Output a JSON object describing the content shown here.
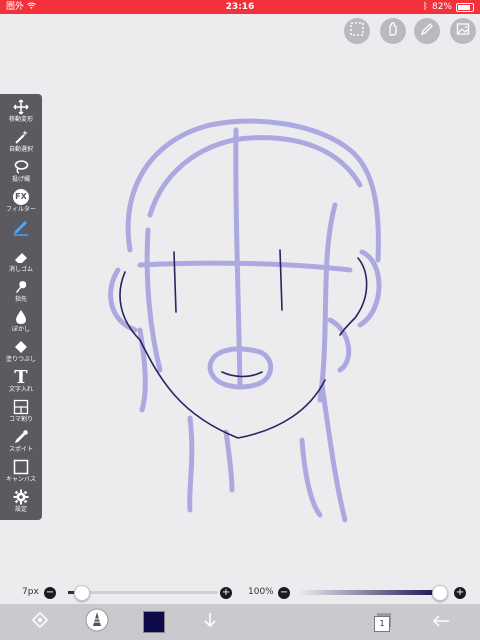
{
  "status": {
    "carrier": "圏外",
    "time": "23:16",
    "battery": "82%"
  },
  "top_buttons": [
    {
      "name": "selection-icon"
    },
    {
      "name": "hand-icon"
    },
    {
      "name": "pen-icon"
    },
    {
      "name": "layers-image-icon"
    }
  ],
  "tools": [
    {
      "label": "移動変形",
      "icon": "move-icon"
    },
    {
      "label": "自動選択",
      "icon": "magic-wand-icon"
    },
    {
      "label": "投げ縄",
      "icon": "lasso-icon"
    },
    {
      "label": "フィルター",
      "icon": "fx-icon",
      "glyph": "FX"
    },
    {
      "label": "",
      "icon": "pen-tool-icon",
      "active": true
    },
    {
      "label": "消しゴム",
      "icon": "eraser-icon"
    },
    {
      "label": "指先",
      "icon": "finger-icon"
    },
    {
      "label": "ぼかし",
      "icon": "blur-icon"
    },
    {
      "label": "塗りつぶし",
      "icon": "bucket-icon"
    },
    {
      "label": "文字入れ",
      "icon": "text-icon",
      "glyph": "T"
    },
    {
      "label": "コマ割り",
      "icon": "frame-icon"
    },
    {
      "label": "スポイト",
      "icon": "eyedropper-icon"
    },
    {
      "label": "キャンバス",
      "icon": "canvas-icon"
    },
    {
      "label": "設定",
      "icon": "gear-icon"
    }
  ],
  "brush_size": {
    "value": "7px",
    "level": 0.08,
    "minus": "−",
    "plus": "+"
  },
  "opacity": {
    "value": "100%",
    "level": 1.0,
    "minus": "−",
    "plus": "+"
  },
  "bottom": {
    "current_color": "#0e0a4a",
    "layers_count": "1",
    "icons": [
      "transform-icon",
      "brush-preview-icon",
      "color-swatch",
      "download-icon",
      "layers-icon",
      "back-arrow-icon"
    ]
  },
  "colors": {
    "sketch": "#a9a6e0",
    "ink": "#2a2360",
    "accent": "#f2313a",
    "active_tool": "#4aa8ff"
  }
}
